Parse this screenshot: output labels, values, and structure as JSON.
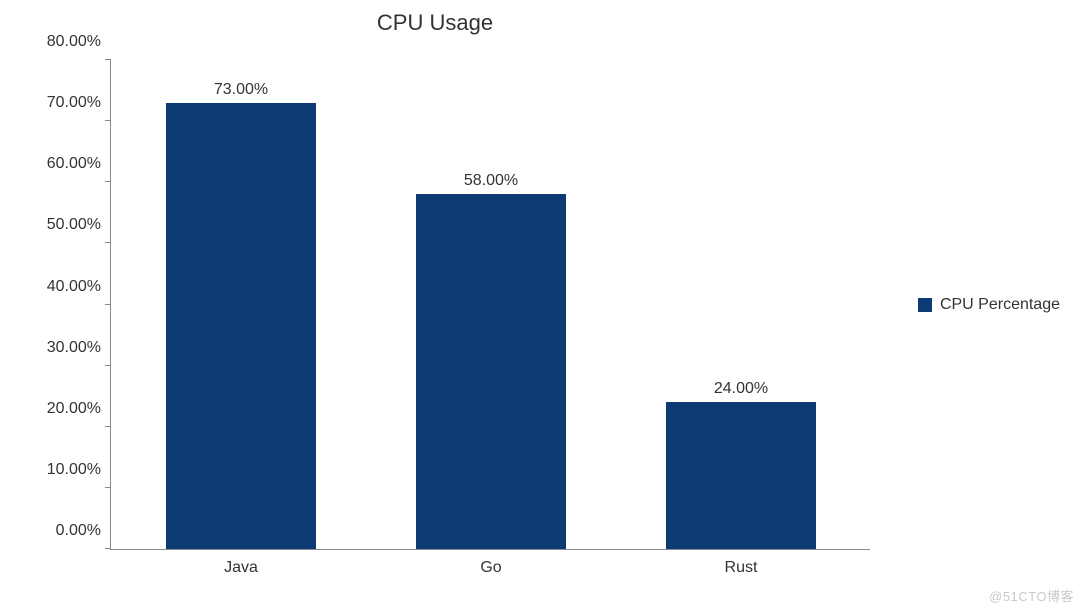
{
  "chart_data": {
    "type": "bar",
    "title": "CPU Usage",
    "categories": [
      "Java",
      "Go",
      "Rust"
    ],
    "series": [
      {
        "name": "CPU Percentage",
        "values": [
          73.0,
          58.0,
          24.0
        ],
        "color": "#0d3a73"
      }
    ],
    "value_labels": [
      "73.00%",
      "58.00%",
      "24.00%"
    ],
    "xlabel": "",
    "ylabel": "",
    "ylim": [
      0,
      80
    ],
    "y_ticks": [
      0,
      10,
      20,
      30,
      40,
      50,
      60,
      70,
      80
    ],
    "y_tick_labels": [
      "0.00%",
      "10.00%",
      "20.00%",
      "30.00%",
      "40.00%",
      "50.00%",
      "60.00%",
      "70.00%",
      "80.00%"
    ],
    "legend_position": "right",
    "grid": false
  },
  "watermark": "@51CTO博客"
}
